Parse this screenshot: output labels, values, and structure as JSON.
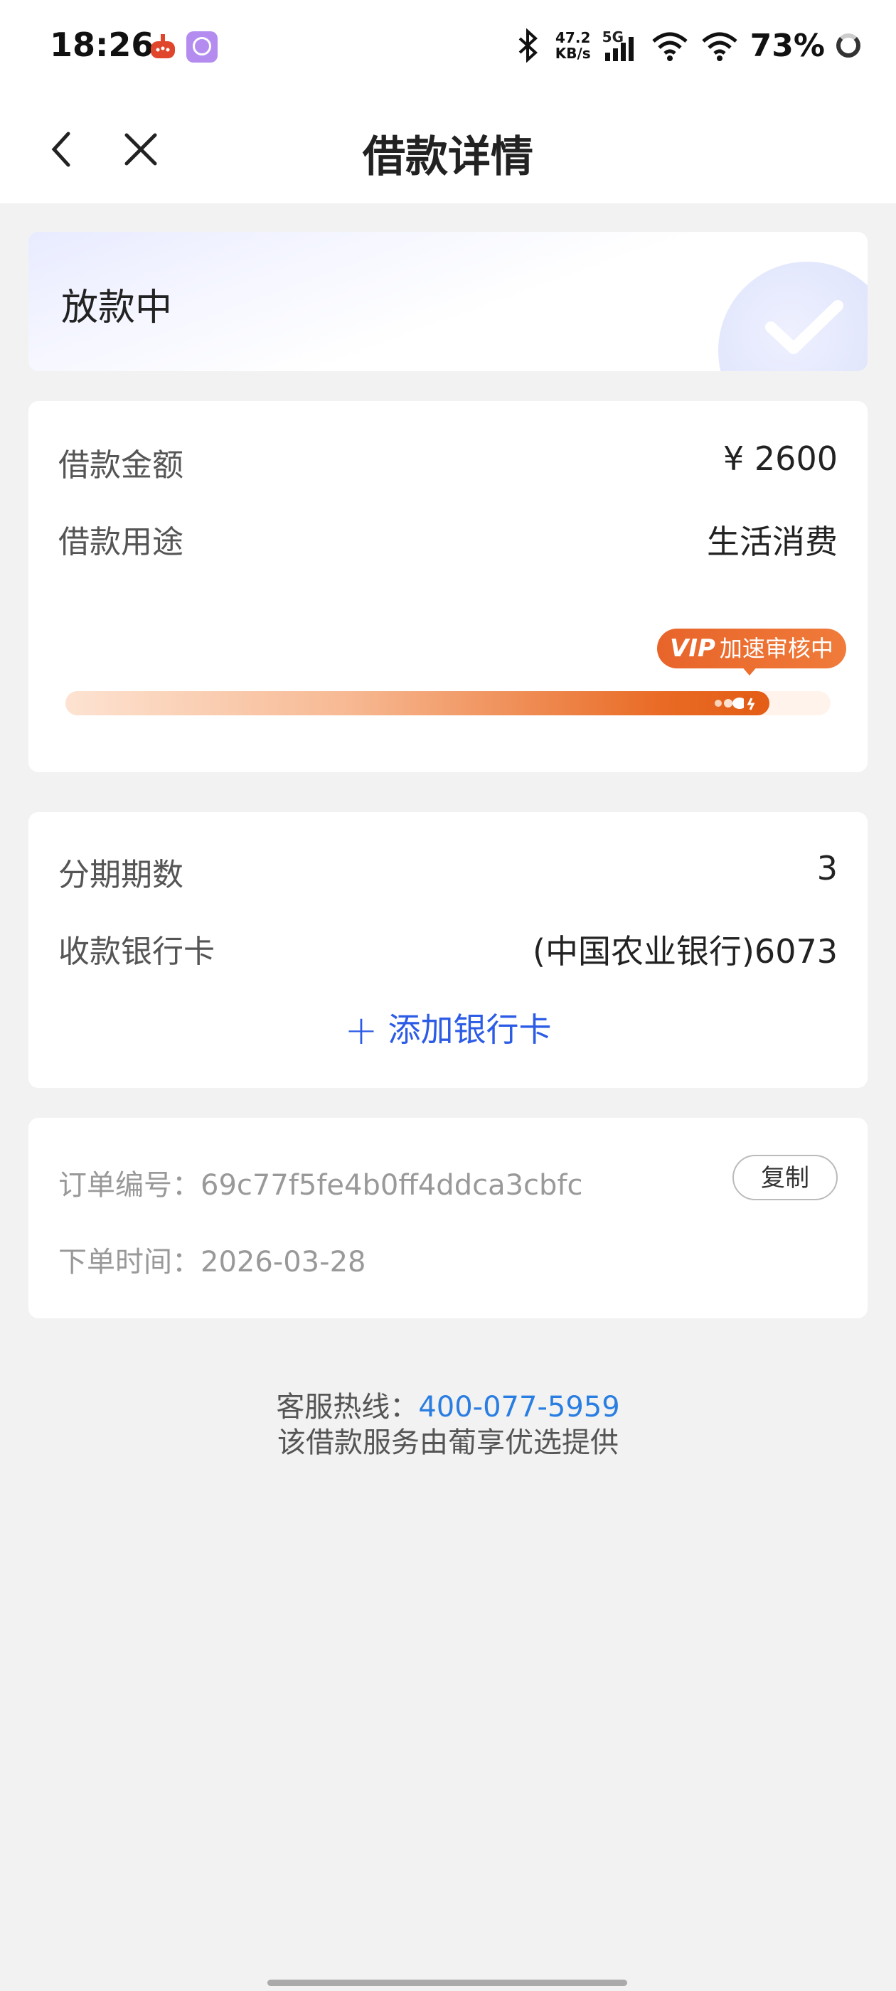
{
  "status_bar": {
    "time": "18:26",
    "net_speed_value": "47.2",
    "net_speed_unit": "KB/s",
    "signal_type": "5G",
    "battery": "73%"
  },
  "nav": {
    "title": "借款详情"
  },
  "status": {
    "text": "放款中"
  },
  "loan": {
    "amount_label": "借款金额",
    "amount_value": "¥ 2600",
    "purpose_label": "借款用途",
    "purpose_value": "生活消费",
    "vip_badge_mark": "VIP",
    "vip_badge_text": "加速审核中",
    "progress_fraction": 0.92
  },
  "installment": {
    "periods_label": "分期期数",
    "periods_value": "3",
    "bank_label": "收款银行卡",
    "bank_value": "(中国农业银行)6073",
    "add_card_plus": "+",
    "add_card_label": "添加银行卡"
  },
  "order": {
    "number_label": "订单编号：",
    "number_value": "69c77f5fe4b0ff4ddca3cbfc",
    "copy_label": "复制",
    "time_label": "下单时间：",
    "time_value": "2026-03-28"
  },
  "footer": {
    "hotline_label": "客服热线：",
    "hotline_number": "400-077-5959",
    "provider_note": "该借款服务由葡享优选提供"
  },
  "colors": {
    "accent_blue": "#2c5be6",
    "link_blue": "#2a7de1",
    "vip_orange": "#e8642a",
    "background": "#f2f2f2"
  }
}
